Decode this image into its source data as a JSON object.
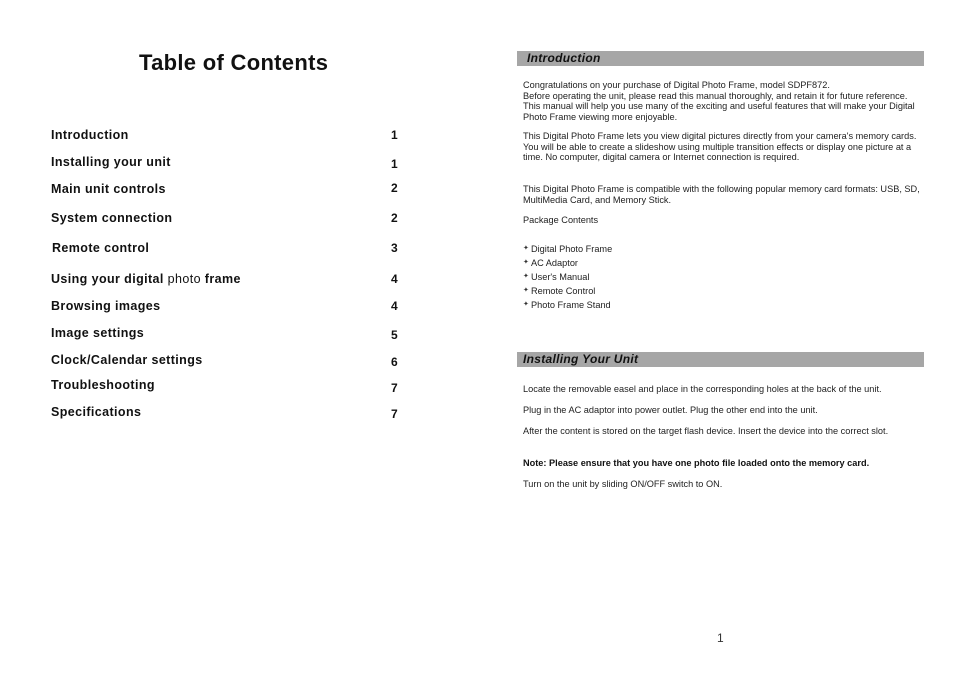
{
  "left_page": {
    "title": "Table of Contents",
    "toc": [
      {
        "label": "Introduction",
        "page": "1"
      },
      {
        "label": "Installing your unit",
        "page": "1"
      },
      {
        "label": "Main unit controls",
        "page": "2"
      },
      {
        "label": "System connection",
        "page": "2"
      },
      {
        "label": "Remote control",
        "page": "3"
      },
      {
        "label_part1": "Using your digital ",
        "label_part2": "photo",
        "label_part3": " frame",
        "page": "4"
      },
      {
        "label": "Browsing images",
        "page": "4"
      },
      {
        "label": "Image settings",
        "page": "5"
      },
      {
        "label": "Clock/Calendar settings",
        "page": "6"
      },
      {
        "label": "Troubleshooting",
        "page": "7"
      },
      {
        "label": "Specifications",
        "page": "7"
      }
    ]
  },
  "right_page": {
    "introduction": {
      "heading": "Introduction",
      "paragraphs": [
        "Congratulations on your purchase of Digital Photo Frame, model SDPF872.",
        "Before operating the unit, please read this manual thoroughly, and retain it for future reference. This manual will help you use many of the exciting and useful features that will make your Digital Photo Frame viewing more enjoyable.",
        "This Digital Photo Frame lets you view digital pictures directly from your camera's memory cards. You will be able to create a slideshow using multiple transition effects or display one picture at a time. No computer, digital camera or Internet connection is required.",
        "This Digital Photo Frame is compatible with the following popular memory card formats: USB, SD, MultiMedia Card, and Memory Stick.",
        "Package Contents"
      ],
      "package_contents": [
        "Digital Photo Frame",
        "AC Adaptor",
        "User's Manual",
        "Remote Control",
        "Photo Frame Stand"
      ]
    },
    "installing": {
      "heading": "Installing Your Unit",
      "paragraphs": [
        "Locate the removable easel and place in the corresponding holes at the back of the unit.",
        "Plug in the AC adaptor into power outlet. Plug the other end into the unit.",
        "After the content is stored on the target flash device. Insert the device into the correct slot.",
        "Note: Please ensure that you have one photo file loaded onto the memory card.",
        "Turn on the unit by sliding ON/OFF switch to ON."
      ]
    },
    "page_number": "1",
    "bullet_glyph": "✦"
  }
}
